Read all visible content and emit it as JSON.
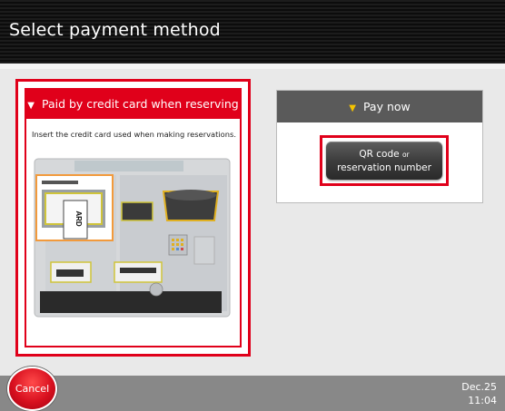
{
  "header": {
    "title": "Select payment method"
  },
  "left_option": {
    "heading_marker": "▼",
    "heading": "Paid by credit card when reserving",
    "instruction": "Insert the credit card used when making reservations.",
    "card_text": "ARD"
  },
  "right_option": {
    "heading_marker": "▼",
    "heading": "Pay now",
    "button_line1": "QR code",
    "button_line1_suffix": "or",
    "button_line2": "reservation number"
  },
  "footer": {
    "cancel_label": "Cancel",
    "date": "Dec.25",
    "time": "11:04"
  },
  "colors": {
    "accent_red": "#e0001a",
    "marker_yellow": "#f5c400",
    "header_dark": "#111111"
  }
}
